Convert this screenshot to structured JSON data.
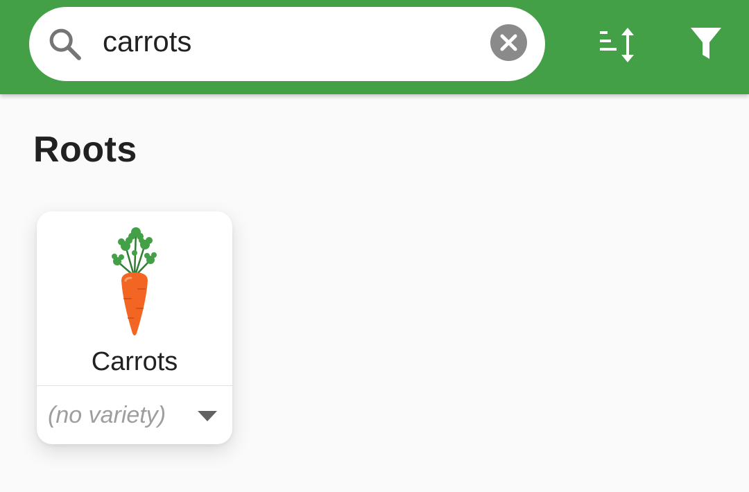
{
  "search": {
    "query": "carrots",
    "icon": "search-icon",
    "clear_icon": "close-icon"
  },
  "toolbar": {
    "sort_icon": "sort-icon",
    "filter_icon": "filter-icon"
  },
  "section": {
    "title": "Roots"
  },
  "items": [
    {
      "name": "Carrots",
      "image_icon": "carrot-icon",
      "variety": "(no variety)",
      "dropdown_icon": "dropdown-arrow-icon"
    }
  ],
  "colors": {
    "appbar": "#43a047",
    "background": "#fafafa",
    "card": "#ffffff",
    "clear_button": "#8a8a8a",
    "placeholder_text": "#9e9e9e"
  }
}
